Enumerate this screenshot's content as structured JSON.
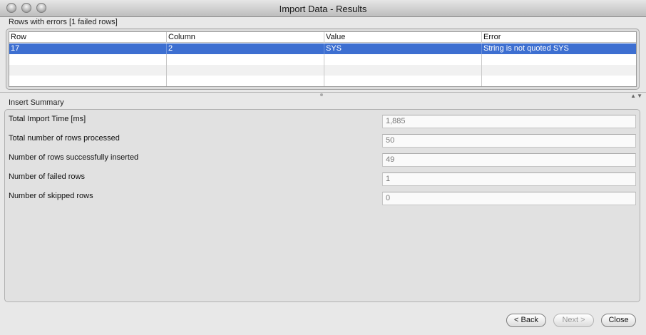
{
  "window": {
    "title": "Import Data - Results"
  },
  "errors": {
    "label": "Rows with errors [1 failed rows]",
    "columns": [
      "Row",
      "Column",
      "Value",
      "Error"
    ],
    "rows": [
      {
        "row": "17",
        "column": "2",
        "value": "SYS",
        "error": "String is not quoted SYS"
      }
    ]
  },
  "summary": {
    "label": "Insert Summary",
    "items": [
      {
        "label": "Total Import Time [ms]",
        "value": "1,885"
      },
      {
        "label": "Total number of rows processed",
        "value": "50"
      },
      {
        "label": "Number of rows successfully inserted",
        "value": "49"
      },
      {
        "label": "Number of failed rows",
        "value": "1"
      },
      {
        "label": "Number of skipped rows",
        "value": "0"
      }
    ]
  },
  "buttons": {
    "back": "< Back",
    "next": "Next >",
    "close": "Close"
  }
}
